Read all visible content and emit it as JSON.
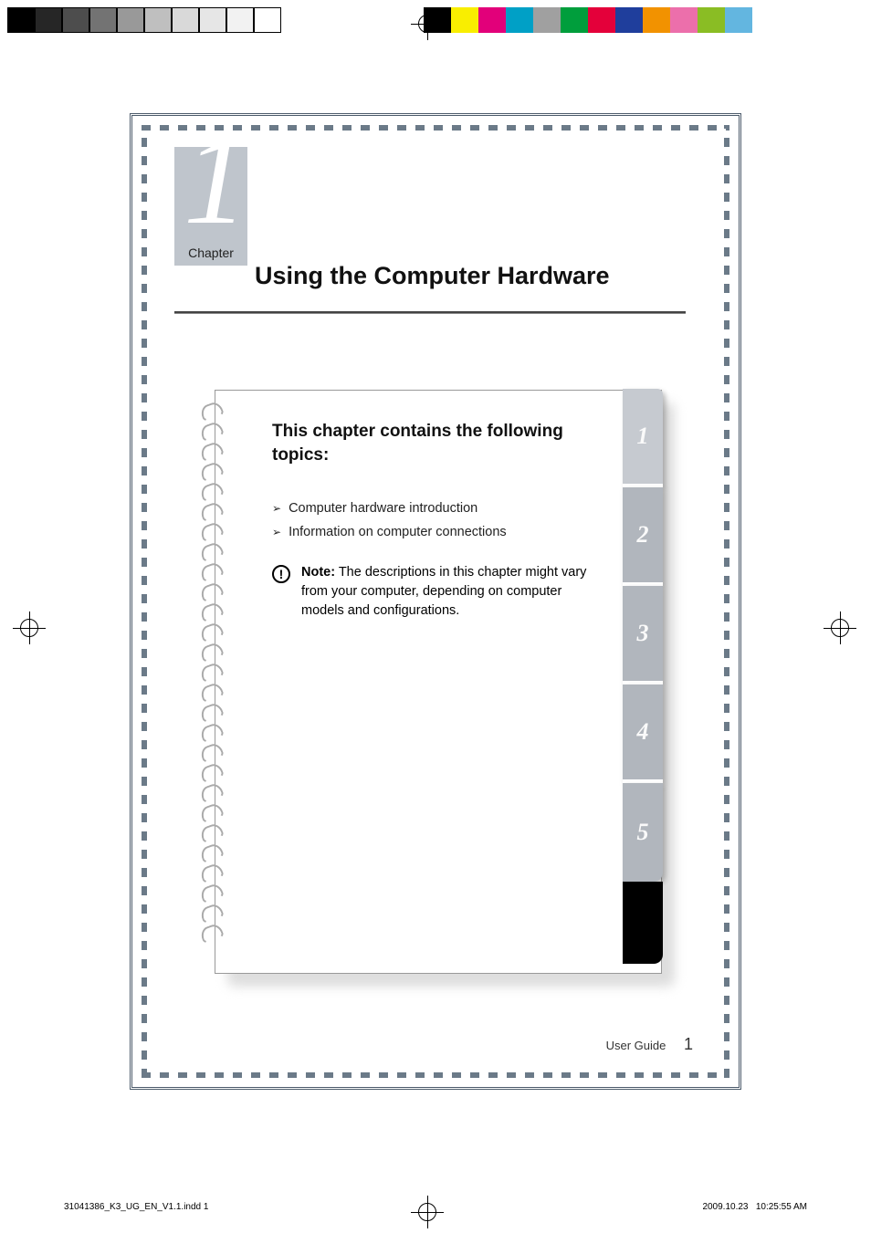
{
  "calibration": {
    "left_grays": [
      "#000000",
      "#262626",
      "#4d4d4d",
      "#737373",
      "#999999",
      "#bfbfbf",
      "#d9d9d9",
      "#e6e6e6",
      "#f2f2f2",
      "#ffffff"
    ],
    "right_colors": [
      "#000000",
      "#f9ee00",
      "#e2007a",
      "#00a0c6",
      "#a0a0a0",
      "#009e3c",
      "#e4003a",
      "#1f3e9c",
      "#f29200",
      "#ec6fab",
      "#8abd24",
      "#63b6e0"
    ]
  },
  "chapter": {
    "label": "Chapter",
    "number": "1",
    "title": "Using the Computer Hardware"
  },
  "notebook": {
    "heading": "This chapter contains the following topics:",
    "tabs": [
      "1",
      "2",
      "3",
      "4",
      "5"
    ],
    "topics": [
      "Computer hardware introduction",
      "Information on computer connections"
    ],
    "note": {
      "label": "Note:",
      "body": " The descriptions in this chapter might vary from your computer, depending on computer models and configurations."
    }
  },
  "footer": {
    "label": "User Guide",
    "page": "1"
  },
  "slug": {
    "file": "31041386_K3_UG_EN_V1.1.indd   1",
    "date": "2009.10.23",
    "time": "10:25:55 AM"
  }
}
